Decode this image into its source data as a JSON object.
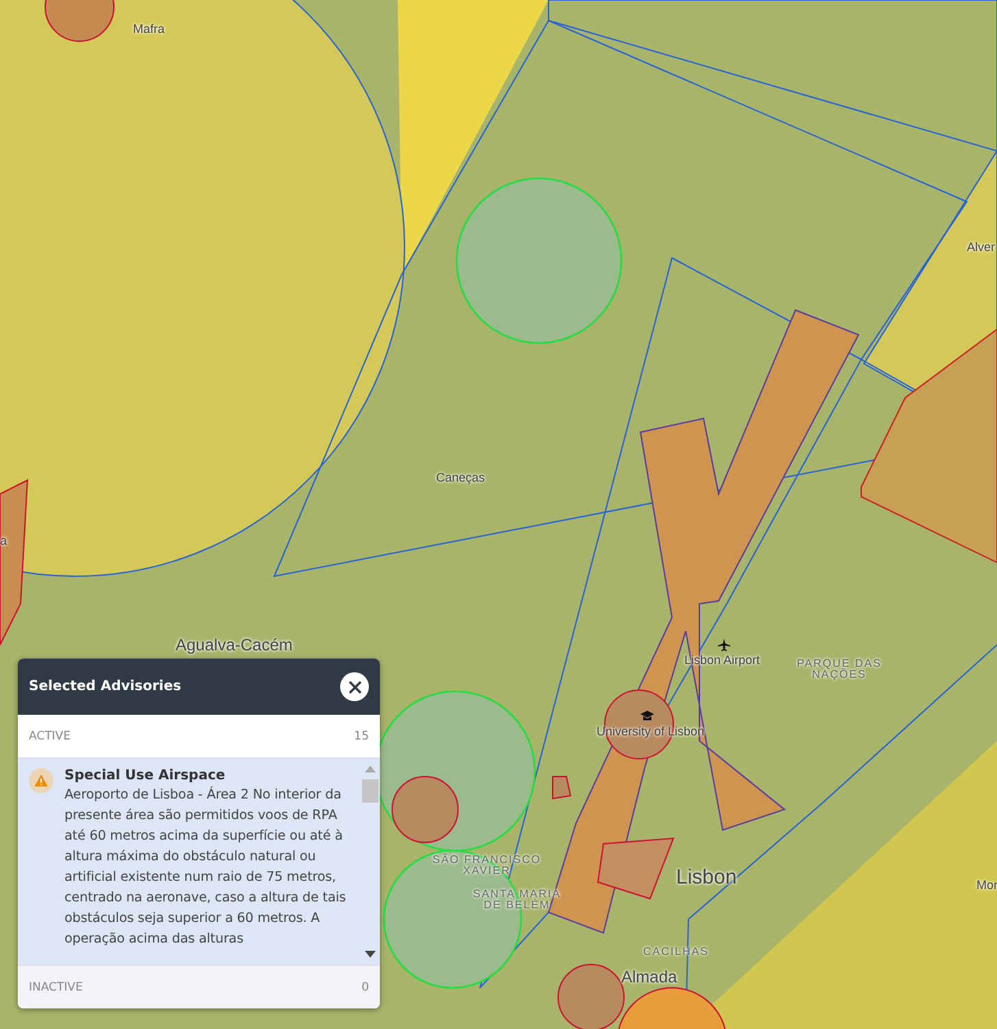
{
  "map": {
    "labels": [
      {
        "text": "Mafra",
        "kind": "town"
      },
      {
        "text": "Caneças",
        "kind": "town"
      },
      {
        "text": "Agualva-Cacém",
        "kind": "city"
      },
      {
        "text": "Alver",
        "kind": "town"
      },
      {
        "text": "a",
        "kind": "town"
      },
      {
        "text": "Lisbon Airport",
        "kind": "airport"
      },
      {
        "text": "PARQUE DAS NAÇÕES",
        "kind": "district"
      },
      {
        "text": "University of Lisbon",
        "kind": "university"
      },
      {
        "text": "SÃO FRANCISCO XAVIER",
        "kind": "district"
      },
      {
        "text": "SANTA MARIA DE BELÉM",
        "kind": "district"
      },
      {
        "text": "Lisbon",
        "kind": "capital"
      },
      {
        "text": "CACILHAS",
        "kind": "district"
      },
      {
        "text": "Almada",
        "kind": "city"
      },
      {
        "text": "Mor",
        "kind": "town"
      }
    ]
  },
  "panel": {
    "title": "Selected Advisories",
    "active": {
      "label": "ACTIVE",
      "count": "15"
    },
    "advisories": [
      {
        "title": "Special Use Airspace",
        "description": "Aeroporto de Lisboa - Área 2 No interior da presente área são permitidos voos de RPA até 60 metros acima da superfície ou até à altura máxima do obstáculo natural ou artificial existente num raio de 75 metros, centrado na aeronave, caso a altura de tais obstáculos seja superior a 60 metros. A operação acima das alturas"
      }
    ],
    "inactive": {
      "label": "INACTIVE",
      "count": "0"
    }
  }
}
